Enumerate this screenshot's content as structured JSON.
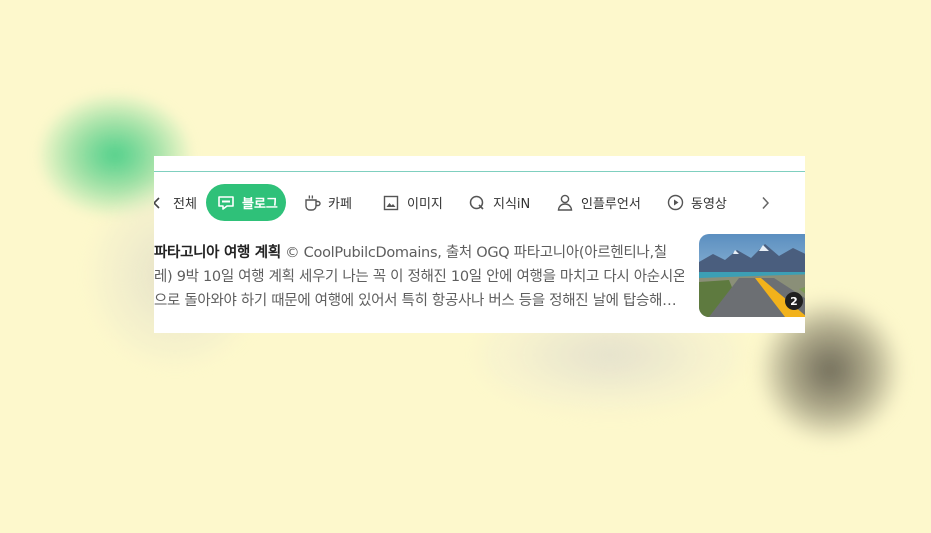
{
  "tabs": {
    "all": {
      "label": "전체",
      "icon": "chevron-left-icon"
    },
    "blog": {
      "label": "블로그",
      "icon": "blog-chat-icon",
      "active": true,
      "color": "#2fc179"
    },
    "cafe": {
      "label": "카페",
      "icon": "coffee-cup-icon"
    },
    "image": {
      "label": "이미지",
      "icon": "image-icon"
    },
    "kin": {
      "label": "지식iN",
      "icon": "q-bubble-icon"
    },
    "influencer": {
      "label": "인플루언서",
      "icon": "person-icon"
    },
    "video": {
      "label": "동영상",
      "icon": "play-circle-icon"
    },
    "more": {
      "icon": "chevron-right-icon"
    }
  },
  "result": {
    "title": "파타고니아 여행 계획",
    "line1_rest": " © CoolPubilcDomains, 출처 OGQ 파타고니아(아르헨티나,칠",
    "line2": "레) 9박 10일 여행 계획 세우기 나는 꼭 이 정해진 10일 안에 여행을 마치고 다시 아순시온",
    "line3": "으로 돌아와야 하기 때문에 여행에 있어서 특히 항공사나 버스 등을 정해진 날에 탑승해야...",
    "thumbnail_count": "2"
  },
  "colors": {
    "accent": "#2fc179",
    "background": "#fdf8cc"
  }
}
